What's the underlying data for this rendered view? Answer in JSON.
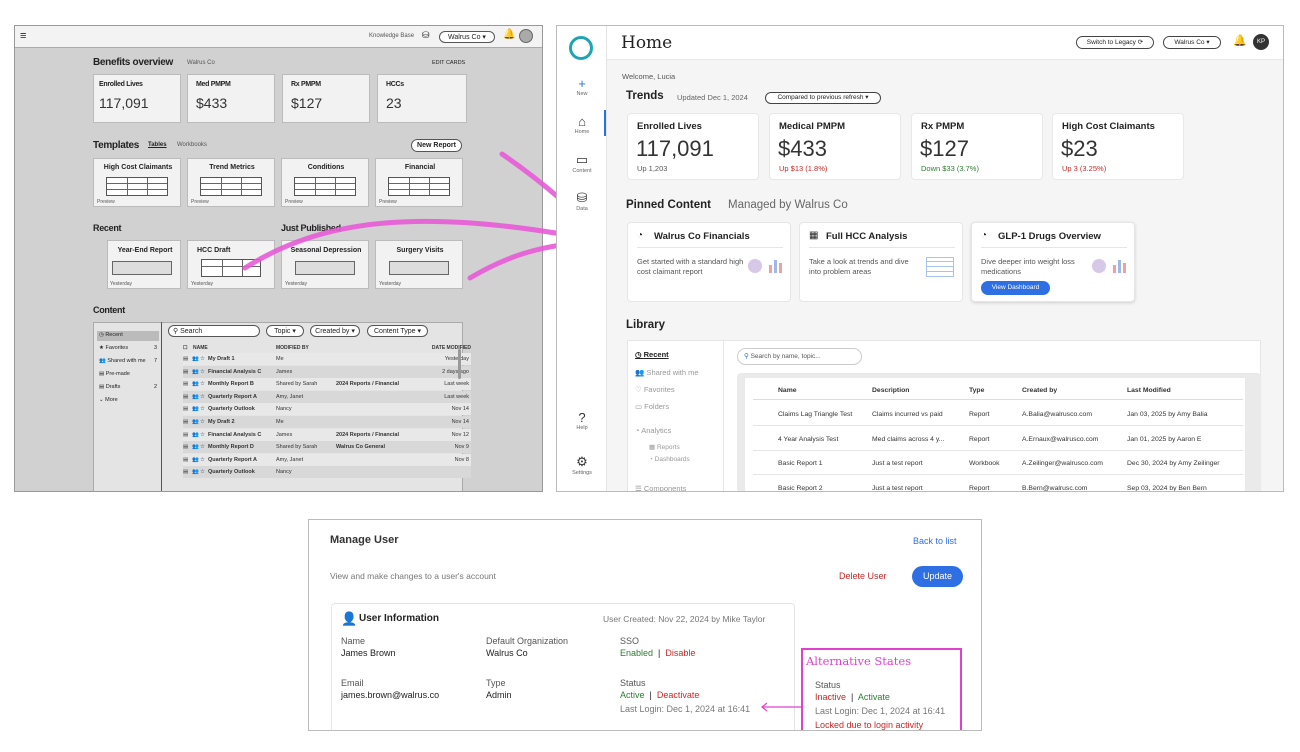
{
  "wireframe": {
    "kb": "Knowledge Base",
    "org": "Walrus Co",
    "benefits": "Benefits overview",
    "benefits_org": "Walrus Co",
    "edit": "EDIT CARDS",
    "cards": [
      {
        "t": "Enrolled Lives",
        "v": "117,091"
      },
      {
        "t": "Med PMPM",
        "v": "$433"
      },
      {
        "t": "Rx PMPM",
        "v": "$127"
      },
      {
        "t": "HCCs",
        "v": "23"
      }
    ],
    "templates": "Templates",
    "tables": "Tables",
    "workbooks": "Workbooks",
    "new_report": "New Report",
    "tmpl": [
      "High Cost Claimants",
      "Trend Metrics",
      "Conditions",
      "Financial"
    ],
    "preview": "Preview",
    "recent": "Recent",
    "just_published": "Just Published",
    "rec": [
      "Year-End Report",
      "HCC Draft",
      "Seasonal Depression",
      "Surgery Visits"
    ],
    "yesterday": "Yesterday",
    "content": "Content",
    "side": [
      {
        "l": "Recent",
        "n": ""
      },
      {
        "l": "Favorites",
        "n": "3"
      },
      {
        "l": "Shared with me",
        "n": "7"
      },
      {
        "l": "Pre-made",
        "n": ""
      },
      {
        "l": "Drafts",
        "n": "2"
      },
      {
        "l": "More",
        "n": ""
      }
    ],
    "search": "Search",
    "topic": "Topic",
    "created": "Created by",
    "ctype": "Content Type",
    "cols": [
      "NAME",
      "MODIFIED BY",
      "DATE MODIFIED"
    ],
    "rows": [
      {
        "n": "My Draft 1",
        "m": "Me",
        "x": "",
        "d": "Yesterday"
      },
      {
        "n": "Financial Analysis C",
        "m": "James",
        "x": "",
        "d": "2 days ago"
      },
      {
        "n": "Monthly Report B",
        "m": "Shared by Sarah",
        "x": "2024 Reports / Financial",
        "d": "Last week"
      },
      {
        "n": "Quarterly Report A",
        "m": "Amy, Janet",
        "x": "",
        "d": "Last week"
      },
      {
        "n": "Quarterly Outlook",
        "m": "Nancy",
        "x": "",
        "d": "Nov 14"
      },
      {
        "n": "My Draft 2",
        "m": "Me",
        "x": "",
        "d": "Nov 14"
      },
      {
        "n": "Financial Analysis C",
        "m": "James",
        "x": "2024 Reports / Financial",
        "d": "Nov 12"
      },
      {
        "n": "Monthly Report D",
        "m": "Shared by Sarah",
        "x": "Walrus Co General",
        "d": "Nov 9"
      },
      {
        "n": "Quarterly Report A",
        "m": "Amy, Janet",
        "x": "",
        "d": "Nov 8"
      },
      {
        "n": "Quarterly Outlook",
        "m": "Nancy",
        "x": "",
        "d": ""
      }
    ]
  },
  "home": {
    "title": "Home",
    "legacy": "Switch to Legacy",
    "org": "Walrus Co",
    "avatar": "KP",
    "nav": [
      "New",
      "Home",
      "Content",
      "Data",
      "Help",
      "Settings"
    ],
    "welcome": "Welcome, Lucia",
    "trends": "Trends",
    "updated": "Updated Dec 1, 2024",
    "compare": "Compared to previous refresh",
    "metrics": [
      {
        "t": "Enrolled Lives",
        "v": "117,091",
        "c": "Up 1,203",
        "col": "#555"
      },
      {
        "t": "Medical PMPM",
        "v": "$433",
        "c": "Up $13 (1.8%)",
        "col": "#c62828"
      },
      {
        "t": "Rx PMPM",
        "v": "$127",
        "c": "Down $33 (3.7%)",
        "col": "#2e7d32"
      },
      {
        "t": "High Cost Claimants",
        "v": "$23",
        "c": "Up 3 (3.25%)",
        "col": "#c62828"
      }
    ],
    "pinned": "Pinned Content",
    "managed": "Managed by Walrus Co",
    "pins": [
      {
        "t": "Walrus Co Financials",
        "d": "Get started with a standard high cost claimant report"
      },
      {
        "t": "Full HCC Analysis",
        "d": "Take a look at trends and dive into problem areas"
      },
      {
        "t": "GLP-1 Drugs Overview",
        "d": "Dive deeper into weight loss medications",
        "btn": "View Dashboard"
      }
    ],
    "library": "Library",
    "lib_nav": [
      "Recent",
      "Shared with me",
      "Favorites",
      "Folders",
      "Analytics",
      "Reports",
      "Dashboards",
      "Components"
    ],
    "lib_search": "Search by name, topic...",
    "lib_cols": [
      "Name",
      "Description",
      "Type",
      "Created by",
      "Last Modified"
    ],
    "lib_rows": [
      [
        "Claims Lag Triangle Test",
        "Claims incurred vs paid",
        "Report",
        "A.Balia@walrusco.com",
        "Jan 03, 2025 by Amy Balia"
      ],
      [
        "4 Year Analysis Test",
        "Med claims across 4 y...",
        "Report",
        "A.Ernaux@walrusco.com",
        "Jan 01, 2025 by Aaron E"
      ],
      [
        "Basic Report 1",
        "Just a test report",
        "Workbook",
        "A.Zeilinger@walrusco.com",
        "Dec 30, 2024 by Amy Zeilinger"
      ],
      [
        "Basic Report 2",
        "Just a test report",
        "Report",
        "B.Bern@walrusc.com",
        "Sep 03, 2024 by Ben Bern"
      ]
    ]
  },
  "manage": {
    "title": "Manage User",
    "back": "Back to list",
    "sub": "View and make changes to a user's account",
    "delete": "Delete User",
    "update": "Update",
    "info": "User Information",
    "created": "User Created: Nov 22, 2024 by Mike Taylor",
    "name_l": "Name",
    "name_v": "James Brown",
    "org_l": "Default Organization",
    "org_v": "Walrus Co",
    "sso_l": "SSO",
    "sso_a": "Enabled",
    "sso_b": "Disable",
    "email_l": "Email",
    "email_v": "james.brown@walrus.co",
    "type_l": "Type",
    "type_v": "Admin",
    "status_l": "Status",
    "status_a": "Active",
    "status_b": "Deactivate",
    "login": "Last Login: Dec 1, 2024 at 16:41",
    "alt_title": "Alternative States",
    "alt_status": "Status",
    "alt_a": "Inactive",
    "alt_b": "Activate",
    "alt_login": "Last Login: Dec 1, 2024 at 16:41",
    "alt_locked": "Locked due to login activity"
  },
  "colors": {
    "accent": "#2f6fe4",
    "pink": "#e040d0",
    "teal": "#1fa4b4"
  }
}
